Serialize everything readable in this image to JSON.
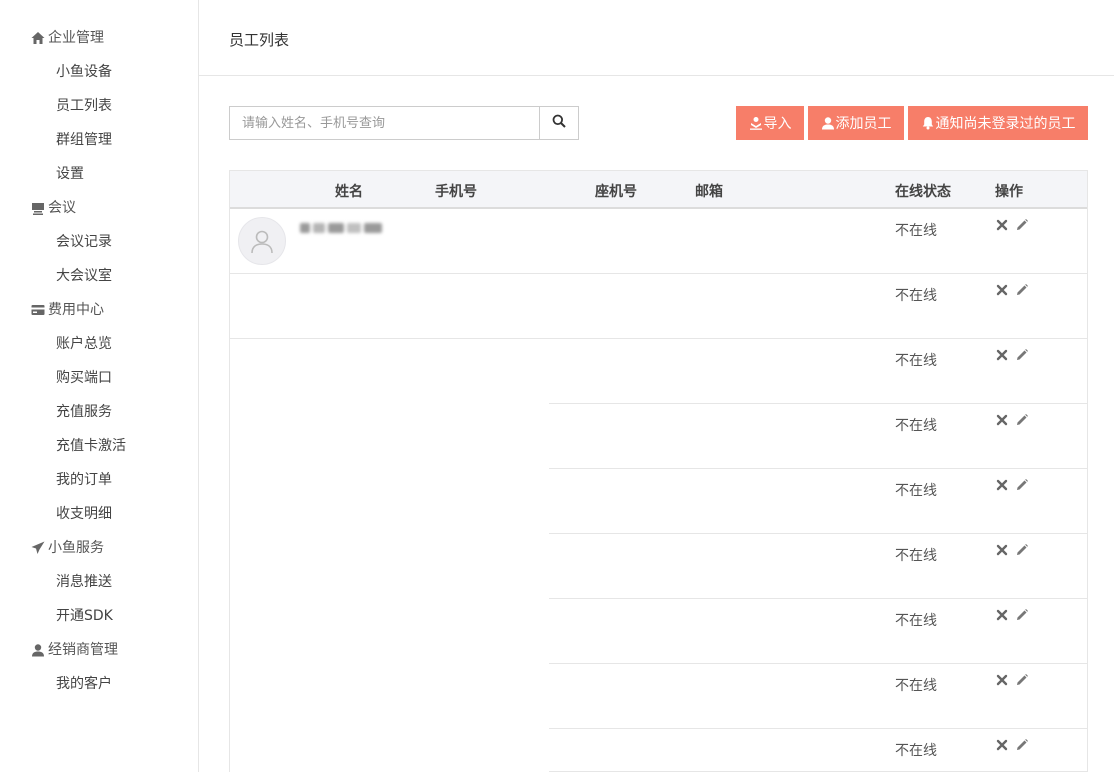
{
  "sidebar": {
    "groups": [
      {
        "label": "企业管理",
        "icon": "home-icon",
        "items": [
          "小鱼设备",
          "员工列表",
          "群组管理",
          "设置"
        ]
      },
      {
        "label": "会议",
        "icon": "meeting-icon",
        "items": [
          "会议记录",
          "大会议室"
        ]
      },
      {
        "label": "费用中心",
        "icon": "credit-card-icon",
        "items": [
          "账户总览",
          "购买端口",
          "充值服务",
          "充值卡激活",
          "我的订单",
          "收支明细"
        ]
      },
      {
        "label": "小鱼服务",
        "icon": "send-icon",
        "items": [
          "消息推送",
          "开通SDK"
        ]
      },
      {
        "label": "经销商管理",
        "icon": "user-icon",
        "items": [
          "我的客户"
        ]
      }
    ]
  },
  "header": {
    "title": "员工列表"
  },
  "toolbar": {
    "search_placeholder": "请输入姓名、手机号查询",
    "import_label": "导入",
    "add_label": "添加员工",
    "notify_label": "通知尚未登录过的员工"
  },
  "table": {
    "columns": [
      "姓名",
      "手机号",
      "座机号",
      "邮箱",
      "在线状态",
      "操作"
    ],
    "rows": [
      {
        "status": "不在线"
      },
      {
        "status": "不在线"
      },
      {
        "status": "不在线"
      },
      {
        "status": "不在线"
      },
      {
        "status": "不在线"
      },
      {
        "status": "不在线"
      },
      {
        "status": "不在线"
      },
      {
        "status": "不在线"
      },
      {
        "status": "不在线"
      }
    ]
  },
  "colors": {
    "accent": "#f77e69",
    "header_bg": "#f4f5f8",
    "border": "#e6e6e6"
  }
}
